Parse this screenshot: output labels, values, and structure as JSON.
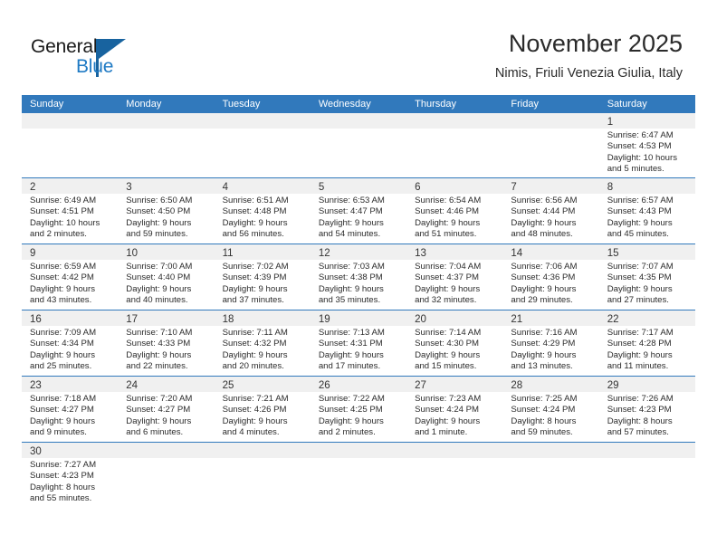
{
  "brand": {
    "name_part1": "General",
    "name_part2": "Blue",
    "accent_color": "#1f7ac4",
    "flag_color": "#18639f"
  },
  "header": {
    "title": "November 2025",
    "subtitle": "Nimis, Friuli Venezia Giulia, Italy"
  },
  "calendar": {
    "header_bg": "#3179bc",
    "daynum_bg": "#f0f0f0",
    "weekdays": [
      "Sunday",
      "Monday",
      "Tuesday",
      "Wednesday",
      "Thursday",
      "Friday",
      "Saturday"
    ],
    "labels": {
      "sunrise": "Sunrise:",
      "sunset": "Sunset:",
      "daylight": "Daylight:"
    },
    "weeks": [
      [
        {
          "day": ""
        },
        {
          "day": ""
        },
        {
          "day": ""
        },
        {
          "day": ""
        },
        {
          "day": ""
        },
        {
          "day": ""
        },
        {
          "day": "1",
          "sunrise": "Sunrise: 6:47 AM",
          "sunset": "Sunset: 4:53 PM",
          "daylight_line1": "Daylight: 10 hours",
          "daylight_line2": "and 5 minutes."
        }
      ],
      [
        {
          "day": "2",
          "sunrise": "Sunrise: 6:49 AM",
          "sunset": "Sunset: 4:51 PM",
          "daylight_line1": "Daylight: 10 hours",
          "daylight_line2": "and 2 minutes."
        },
        {
          "day": "3",
          "sunrise": "Sunrise: 6:50 AM",
          "sunset": "Sunset: 4:50 PM",
          "daylight_line1": "Daylight: 9 hours",
          "daylight_line2": "and 59 minutes."
        },
        {
          "day": "4",
          "sunrise": "Sunrise: 6:51 AM",
          "sunset": "Sunset: 4:48 PM",
          "daylight_line1": "Daylight: 9 hours",
          "daylight_line2": "and 56 minutes."
        },
        {
          "day": "5",
          "sunrise": "Sunrise: 6:53 AM",
          "sunset": "Sunset: 4:47 PM",
          "daylight_line1": "Daylight: 9 hours",
          "daylight_line2": "and 54 minutes."
        },
        {
          "day": "6",
          "sunrise": "Sunrise: 6:54 AM",
          "sunset": "Sunset: 4:46 PM",
          "daylight_line1": "Daylight: 9 hours",
          "daylight_line2": "and 51 minutes."
        },
        {
          "day": "7",
          "sunrise": "Sunrise: 6:56 AM",
          "sunset": "Sunset: 4:44 PM",
          "daylight_line1": "Daylight: 9 hours",
          "daylight_line2": "and 48 minutes."
        },
        {
          "day": "8",
          "sunrise": "Sunrise: 6:57 AM",
          "sunset": "Sunset: 4:43 PM",
          "daylight_line1": "Daylight: 9 hours",
          "daylight_line2": "and 45 minutes."
        }
      ],
      [
        {
          "day": "9",
          "sunrise": "Sunrise: 6:59 AM",
          "sunset": "Sunset: 4:42 PM",
          "daylight_line1": "Daylight: 9 hours",
          "daylight_line2": "and 43 minutes."
        },
        {
          "day": "10",
          "sunrise": "Sunrise: 7:00 AM",
          "sunset": "Sunset: 4:40 PM",
          "daylight_line1": "Daylight: 9 hours",
          "daylight_line2": "and 40 minutes."
        },
        {
          "day": "11",
          "sunrise": "Sunrise: 7:02 AM",
          "sunset": "Sunset: 4:39 PM",
          "daylight_line1": "Daylight: 9 hours",
          "daylight_line2": "and 37 minutes."
        },
        {
          "day": "12",
          "sunrise": "Sunrise: 7:03 AM",
          "sunset": "Sunset: 4:38 PM",
          "daylight_line1": "Daylight: 9 hours",
          "daylight_line2": "and 35 minutes."
        },
        {
          "day": "13",
          "sunrise": "Sunrise: 7:04 AM",
          "sunset": "Sunset: 4:37 PM",
          "daylight_line1": "Daylight: 9 hours",
          "daylight_line2": "and 32 minutes."
        },
        {
          "day": "14",
          "sunrise": "Sunrise: 7:06 AM",
          "sunset": "Sunset: 4:36 PM",
          "daylight_line1": "Daylight: 9 hours",
          "daylight_line2": "and 29 minutes."
        },
        {
          "day": "15",
          "sunrise": "Sunrise: 7:07 AM",
          "sunset": "Sunset: 4:35 PM",
          "daylight_line1": "Daylight: 9 hours",
          "daylight_line2": "and 27 minutes."
        }
      ],
      [
        {
          "day": "16",
          "sunrise": "Sunrise: 7:09 AM",
          "sunset": "Sunset: 4:34 PM",
          "daylight_line1": "Daylight: 9 hours",
          "daylight_line2": "and 25 minutes."
        },
        {
          "day": "17",
          "sunrise": "Sunrise: 7:10 AM",
          "sunset": "Sunset: 4:33 PM",
          "daylight_line1": "Daylight: 9 hours",
          "daylight_line2": "and 22 minutes."
        },
        {
          "day": "18",
          "sunrise": "Sunrise: 7:11 AM",
          "sunset": "Sunset: 4:32 PM",
          "daylight_line1": "Daylight: 9 hours",
          "daylight_line2": "and 20 minutes."
        },
        {
          "day": "19",
          "sunrise": "Sunrise: 7:13 AM",
          "sunset": "Sunset: 4:31 PM",
          "daylight_line1": "Daylight: 9 hours",
          "daylight_line2": "and 17 minutes."
        },
        {
          "day": "20",
          "sunrise": "Sunrise: 7:14 AM",
          "sunset": "Sunset: 4:30 PM",
          "daylight_line1": "Daylight: 9 hours",
          "daylight_line2": "and 15 minutes."
        },
        {
          "day": "21",
          "sunrise": "Sunrise: 7:16 AM",
          "sunset": "Sunset: 4:29 PM",
          "daylight_line1": "Daylight: 9 hours",
          "daylight_line2": "and 13 minutes."
        },
        {
          "day": "22",
          "sunrise": "Sunrise: 7:17 AM",
          "sunset": "Sunset: 4:28 PM",
          "daylight_line1": "Daylight: 9 hours",
          "daylight_line2": "and 11 minutes."
        }
      ],
      [
        {
          "day": "23",
          "sunrise": "Sunrise: 7:18 AM",
          "sunset": "Sunset: 4:27 PM",
          "daylight_line1": "Daylight: 9 hours",
          "daylight_line2": "and 9 minutes."
        },
        {
          "day": "24",
          "sunrise": "Sunrise: 7:20 AM",
          "sunset": "Sunset: 4:27 PM",
          "daylight_line1": "Daylight: 9 hours",
          "daylight_line2": "and 6 minutes."
        },
        {
          "day": "25",
          "sunrise": "Sunrise: 7:21 AM",
          "sunset": "Sunset: 4:26 PM",
          "daylight_line1": "Daylight: 9 hours",
          "daylight_line2": "and 4 minutes."
        },
        {
          "day": "26",
          "sunrise": "Sunrise: 7:22 AM",
          "sunset": "Sunset: 4:25 PM",
          "daylight_line1": "Daylight: 9 hours",
          "daylight_line2": "and 2 minutes."
        },
        {
          "day": "27",
          "sunrise": "Sunrise: 7:23 AM",
          "sunset": "Sunset: 4:24 PM",
          "daylight_line1": "Daylight: 9 hours",
          "daylight_line2": "and 1 minute."
        },
        {
          "day": "28",
          "sunrise": "Sunrise: 7:25 AM",
          "sunset": "Sunset: 4:24 PM",
          "daylight_line1": "Daylight: 8 hours",
          "daylight_line2": "and 59 minutes."
        },
        {
          "day": "29",
          "sunrise": "Sunrise: 7:26 AM",
          "sunset": "Sunset: 4:23 PM",
          "daylight_line1": "Daylight: 8 hours",
          "daylight_line2": "and 57 minutes."
        }
      ],
      [
        {
          "day": "30",
          "sunrise": "Sunrise: 7:27 AM",
          "sunset": "Sunset: 4:23 PM",
          "daylight_line1": "Daylight: 8 hours",
          "daylight_line2": "and 55 minutes."
        },
        {
          "day": ""
        },
        {
          "day": ""
        },
        {
          "day": ""
        },
        {
          "day": ""
        },
        {
          "day": ""
        },
        {
          "day": ""
        }
      ]
    ]
  }
}
